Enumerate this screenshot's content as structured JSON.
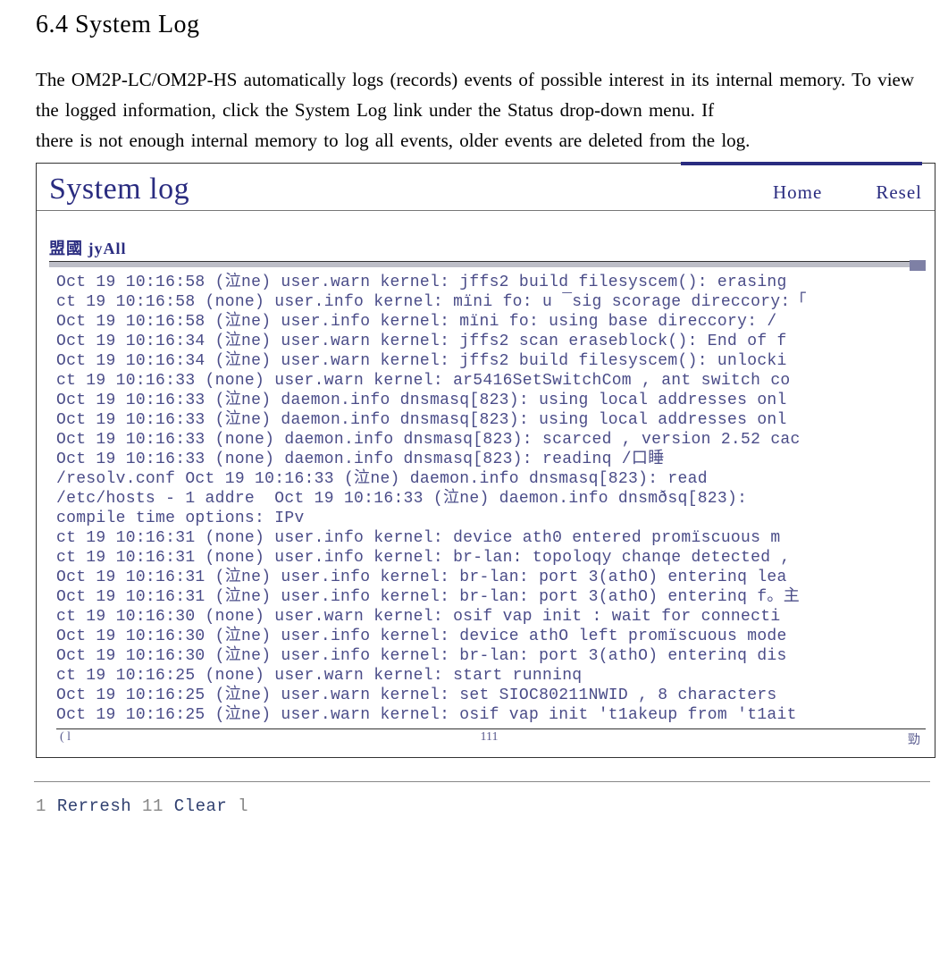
{
  "doc": {
    "section_title": "6.4 System Log",
    "para1": "The OM2P-LC/OM2P-HS automatically logs (records) events of possible interest in its internal memory. To view the logged information, click the System Log link under the Status drop-down menu. If",
    "para2": "there is not enough internal memory to log all events, older events are deleted from the log."
  },
  "panel": {
    "title": "System log",
    "nav_home": "Home",
    "nav_reset": "Resel",
    "sub_label": "盟國 jyAll"
  },
  "log": {
    "lines": [
      "Oct 19 10:16:58 (泣ne) user.warn kernel: jffs2 build filesyscem(): erasing",
      "ct 19 10:16:58 (none) user.info kernel: mïni fo: u ¯sig scorage direccory:「",
      "Oct 19 10:16:58 (泣ne) user.info kernel: mïni fo: using base direccory: /",
      "Oct 19 10:16:34 (泣ne) user.warn kernel: jffs2 scan eraseblock(): End of f",
      "Oct 19 10:16:34 (泣ne) user.warn kernel: jffs2 build filesyscem(): unlocki",
      "ct 19 10:16:33 (none) user.warn kernel: ar5416SetSwitchCom , ant switch co",
      "Oct 19 10:16:33 (泣ne) daemon.info dnsmasq[823): using local addresses onl",
      "Oct 19 10:16:33 (泣ne) daemon.info dnsmasq[823): using local addresses onl",
      "Oct 19 10:16:33 (none) daemon.info dnsmasq[823): scarced , version 2.52 cac",
      "Oct 19 10:16:33 (none) daemon.info dnsmasq[823): readinq /口睡",
      "/resolv.conf Oct 19 10:16:33 (泣ne) daemon.info dnsmasq[823): read",
      "/etc/hosts - 1 addre  Oct 19 10:16:33 (泣ne) daemon.info dnsmðsq[823):",
      "compile time options: IPv",
      "ct 19 10:16:31 (none) user.info kernel: device ath0 entered promïscuous m",
      "ct 19 10:16:31 (none) user.info kernel: br-lan: topoloqy chanqe detected ,",
      "Oct 19 10:16:31 (泣ne) user.info kernel: br-lan: port 3(athO) enterinq lea",
      "Oct 19 10:16:31 (泣ne) user.info kernel: br-lan: port 3(athO) enterinq f。主",
      "ct 19 10:16:30 (none) user.warn kernel: osif vap init : wait for connecti",
      "Oct 19 10:16:30 (泣ne) user.info kernel: device athO left promïscuous mode",
      "Oct 19 10:16:30 (泣ne) user.info kernel: br-lan: port 3(athO) enterinq dis",
      "ct 19 10:16:25 (none) user.warn kernel: start runninq",
      "Oct 19 10:16:25 (泣ne) user.warn kernel: set SIOC80211NWID , 8 characters",
      "Oct 19 10:16:25 (泣ne) user.warn kernel: osif vap init 't1akeup from 't1ait"
    ]
  },
  "scrollfoot": {
    "left": "( l",
    "mid": "111",
    "right": "勁"
  },
  "footer": {
    "refresh": "Rerresh",
    "clear": "Clear"
  }
}
